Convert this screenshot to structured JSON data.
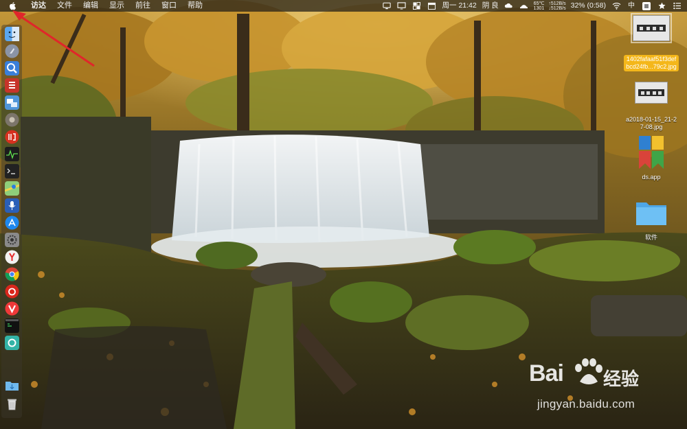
{
  "menubar": {
    "app_name": "访达",
    "menus": [
      "文件",
      "编辑",
      "显示",
      "前往",
      "窗口",
      "帮助"
    ],
    "clock": "周一 21:42",
    "weather": "阴 良",
    "temps": [
      "65℃",
      "1301"
    ],
    "net": [
      "↑512B/s",
      "↓512B/s"
    ],
    "battery": "32% (0:58)",
    "input_method": "中"
  },
  "dock": {
    "icons": [
      "finder-icon",
      "launchpad-icon",
      "preview-icon",
      "sublime-icon",
      "migration-icon",
      "gear-app-icon",
      "pinduoduo-icon",
      "activity-monitor-icon",
      "terminal-icon",
      "maps-icon",
      "siri-icon",
      "app-store-icon",
      "system-preferences-icon",
      "yandex-icon",
      "chrome-icon",
      "netease-music-icon",
      "vivaldi-icon",
      "iterm-icon",
      "cloud-icon",
      "downloads-folder-icon",
      "trash-icon"
    ]
  },
  "desktop": {
    "items": [
      {
        "name": "1402fafaaf51f3defbcd24fb...79c2.jpg",
        "line1": "1402fafaaf51f3def",
        "line2": "bcd24fb...79c2.jpg",
        "selected": true
      },
      {
        "name": "a2018-01-15_21-27-08.jpg",
        "line1": "a2018-01-15_21-2",
        "line2": "7-08.jpg",
        "selected": false
      },
      {
        "name": "ds.app",
        "line1": "ds.app",
        "line2": "",
        "selected": false
      },
      {
        "name": "软件",
        "line1": "软件",
        "line2": "",
        "selected": false
      }
    ]
  },
  "watermark": {
    "brand": "Bai",
    "brand_suffix": "经验",
    "url": "jingyan.baidu.com"
  },
  "colors": {
    "menubar_bg": "#1e1c16",
    "selected_label": "#f4b71a",
    "annotation_arrow": "#e0262b",
    "folder_blue": "#5ab4ef"
  }
}
